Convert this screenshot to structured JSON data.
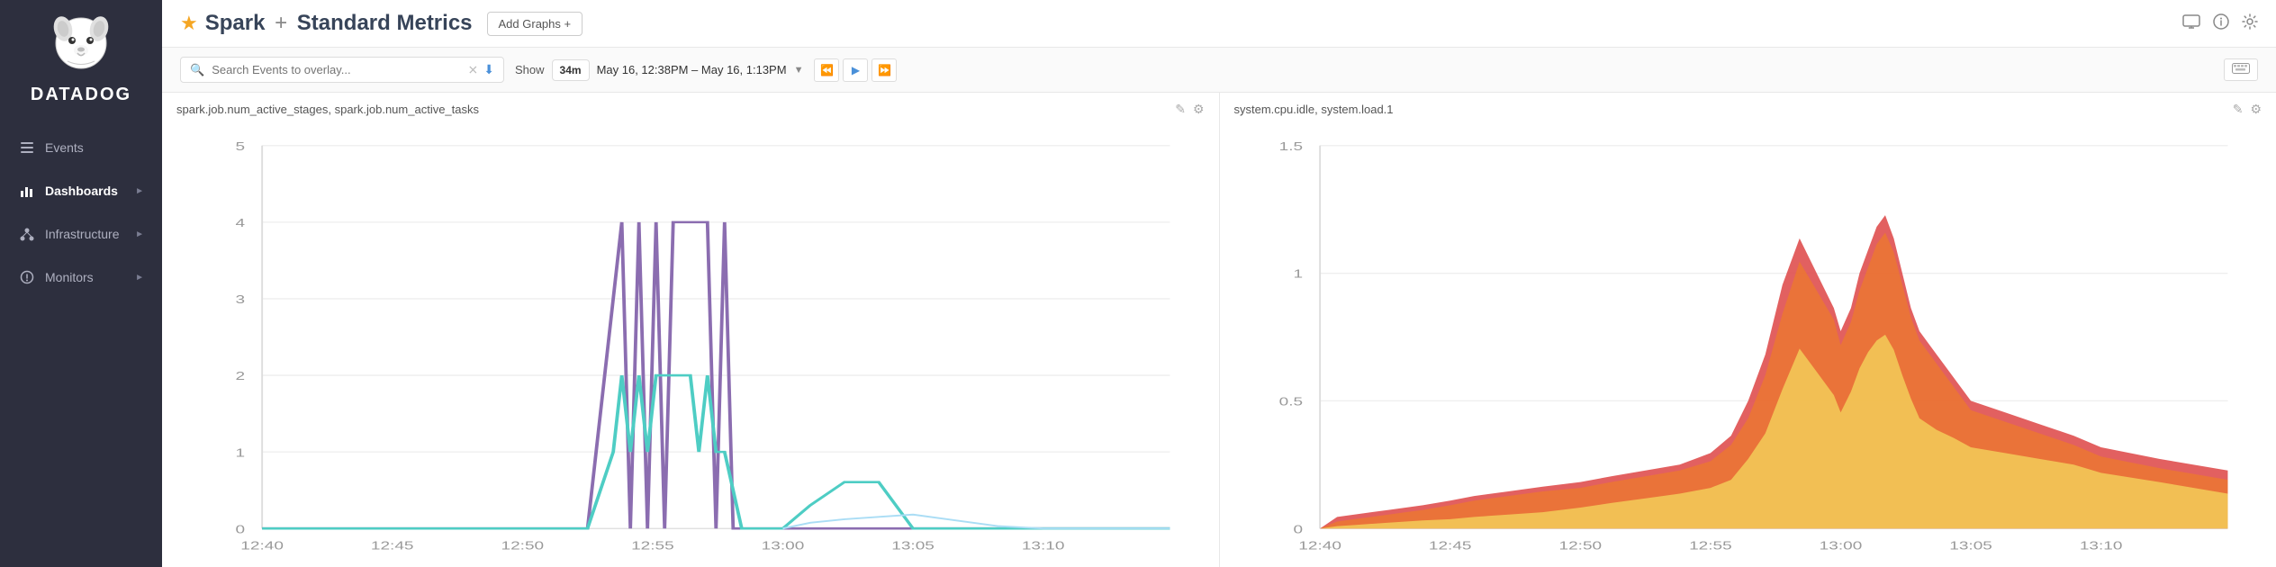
{
  "sidebar": {
    "brand": "DATADOG",
    "nav_items": [
      {
        "id": "events",
        "label": "Events",
        "icon": "list-icon",
        "active": false,
        "has_chevron": false
      },
      {
        "id": "dashboards",
        "label": "Dashboards",
        "icon": "bar-chart-icon",
        "active": true,
        "has_chevron": true
      },
      {
        "id": "infrastructure",
        "label": "Infrastructure",
        "icon": "nodes-icon",
        "active": false,
        "has_chevron": true
      },
      {
        "id": "monitors",
        "label": "Monitors",
        "icon": "alert-icon",
        "active": false,
        "has_chevron": true
      }
    ]
  },
  "header": {
    "title": "Spark + Standard Metrics",
    "add_graphs_label": "Add Graphs +",
    "icons": [
      "monitor-icon",
      "info-icon",
      "settings-icon"
    ]
  },
  "toolbar": {
    "search_placeholder": "Search Events to overlay...",
    "show_label": "Show",
    "time_window": "34m",
    "time_range": "May 16, 12:38PM – May 16, 1:13PM",
    "keyboard_icon": "keyboard-icon"
  },
  "charts": [
    {
      "id": "chart1",
      "title": "spark.job.num_active_stages, spark.job.num_active_tasks",
      "y_max": 5,
      "y_ticks": [
        0,
        1,
        2,
        3,
        4,
        5
      ],
      "x_ticks": [
        "12:40",
        "12:45",
        "12:50",
        "12:55",
        "13:00",
        "13:05",
        "13:10"
      ]
    },
    {
      "id": "chart2",
      "title": "system.cpu.idle, system.load.1",
      "y_max": 1.5,
      "y_ticks": [
        0,
        0.5,
        1,
        1.5
      ],
      "x_ticks": [
        "12:40",
        "12:45",
        "12:50",
        "12:55",
        "13:00",
        "13:05",
        "13:10"
      ]
    }
  ]
}
